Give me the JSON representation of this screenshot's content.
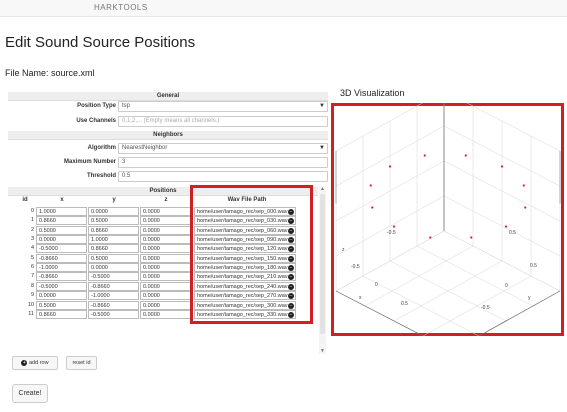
{
  "app": {
    "brand": "HARKTOOLS"
  },
  "page": {
    "title": "Edit Sound Source Positions",
    "file_name": "File Name: source.xml"
  },
  "general": {
    "header": "General",
    "position_type": {
      "label": "Position Type",
      "value": "tsp"
    },
    "use_channels": {
      "label": "Use Channels",
      "placeholder": "0,1,2,... (Empty means all channels.)"
    }
  },
  "neighbors": {
    "header": "Neighbors",
    "algorithm": {
      "label": "Algorithm",
      "value": "NearestNeighbor"
    },
    "max_number": {
      "label": "Maximum Number",
      "value": "3"
    },
    "threshold": {
      "label": "Threshold",
      "value": "0.5"
    }
  },
  "positions": {
    "header": "Positions",
    "columns": [
      "id",
      "x",
      "y",
      "z",
      "Wav File Path"
    ],
    "rows": [
      {
        "id": "0",
        "x": "1.0000",
        "y": "0.0000",
        "z": "0.0000",
        "path": "home/user/tamago_rec/sep_000.wav"
      },
      {
        "id": "1",
        "x": "0.8660",
        "y": "0.5000",
        "z": "0.0000",
        "path": "home/user/tamago_rec/sep_030.wav"
      },
      {
        "id": "2",
        "x": "0.5000",
        "y": "0.8660",
        "z": "0.0000",
        "path": "home/user/tamago_rec/sep_060.wav"
      },
      {
        "id": "3",
        "x": "0.0000",
        "y": "1.0000",
        "z": "0.0000",
        "path": "home/user/tamago_rec/sep_090.wav"
      },
      {
        "id": "4",
        "x": "-0.5000",
        "y": "0.8660",
        "z": "0.0000",
        "path": "home/user/tamago_rec/sep_120.wav"
      },
      {
        "id": "5",
        "x": "-0.8660",
        "y": "0.5000",
        "z": "0.0000",
        "path": "home/user/tamago_rec/sep_150.wav"
      },
      {
        "id": "6",
        "x": "-1.0000",
        "y": "0.0000",
        "z": "0.0000",
        "path": "home/user/tamago_rec/sep_180.wav"
      },
      {
        "id": "7",
        "x": "-0.8660",
        "y": "-0.5000",
        "z": "0.0000",
        "path": "home/user/tamago_rec/sep_210.wav"
      },
      {
        "id": "8",
        "x": "-0.5000",
        "y": "-0.8660",
        "z": "0.0000",
        "path": "home/user/tamago_rec/sep_240.wav"
      },
      {
        "id": "9",
        "x": "0.0000",
        "y": "-1.0000",
        "z": "0.0000",
        "path": "home/user/tamago_rec/sep_270.wav"
      },
      {
        "id": "10",
        "x": "0.5000",
        "y": "-0.8660",
        "z": "0.0000",
        "path": "home/user/tamago_rec/sep_300.wav"
      },
      {
        "id": "11",
        "x": "0.8660",
        "y": "-0.5000",
        "z": "0.0000",
        "path": "home/user/tamago_rec/sep_330.wav"
      }
    ]
  },
  "buttons": {
    "add_row": "add   row",
    "reset_id": "reset id",
    "create": "Create!"
  },
  "visualization": {
    "title": "3D Visualization",
    "axis_labels": {
      "x": "x",
      "y": "y",
      "z": "z"
    },
    "tick_labels": [
      "-0.5",
      "0",
      "0.5",
      "0.5",
      "0",
      "-0.5",
      "0.5",
      "-0.5"
    ],
    "point_color": "#e0202a"
  },
  "colors": {
    "highlight": "#d11f26"
  }
}
